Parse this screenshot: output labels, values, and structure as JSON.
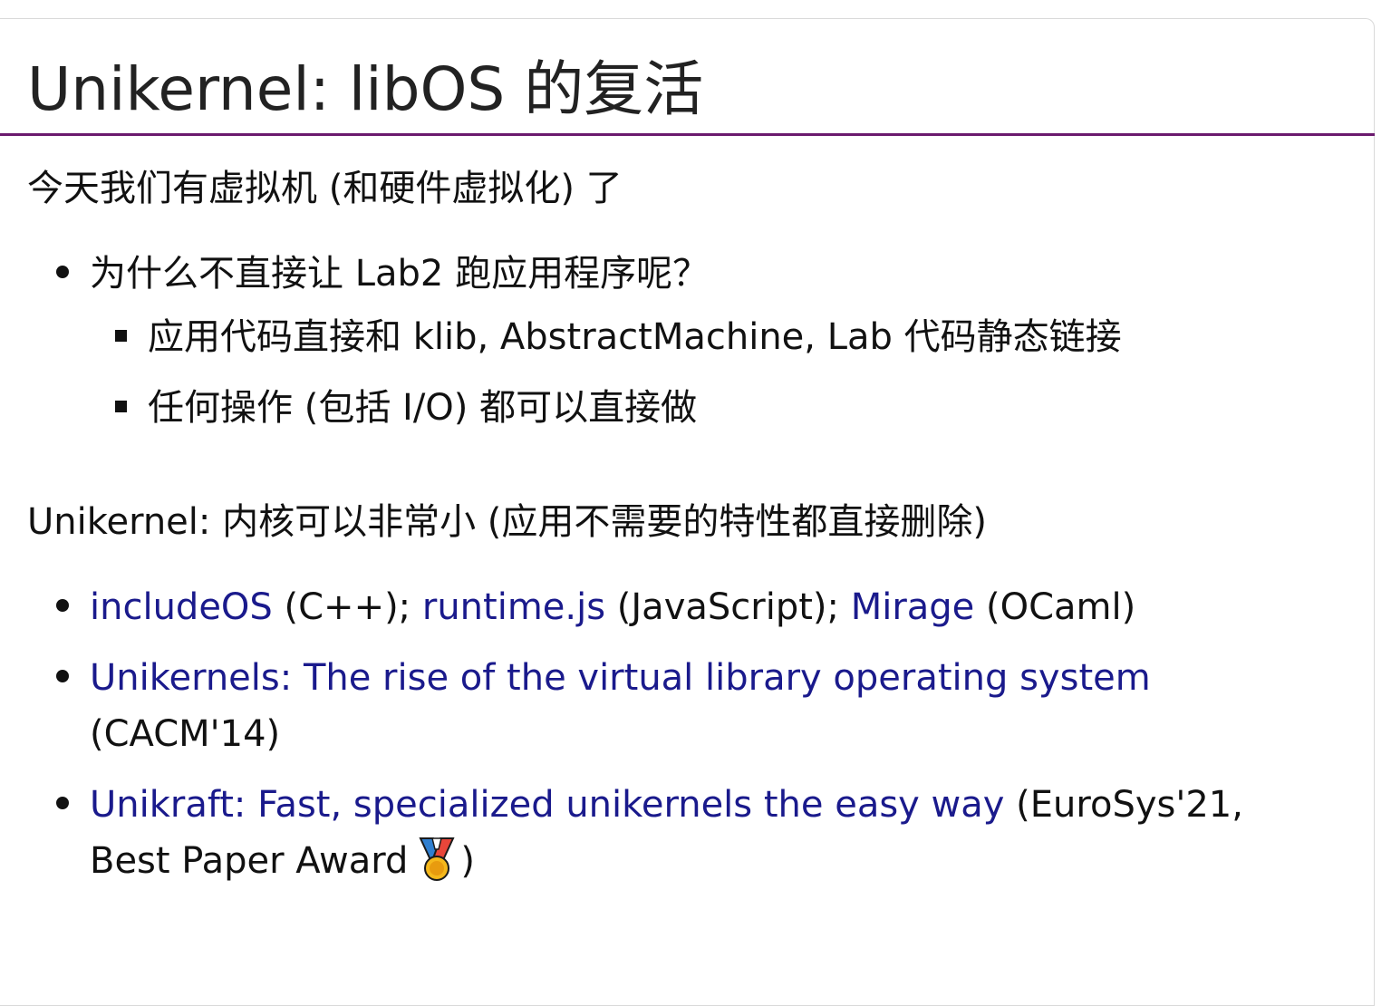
{
  "title": "Unikernel: libOS 的复活",
  "section1": {
    "intro": "今天我们有虚拟机 (和硬件虚拟化) 了",
    "bullet": "为什么不直接让 Lab2 跑应用程序呢？",
    "sub_items": [
      "应用代码直接和 klib, AbstractMachine, Lab 代码静态链接",
      "任何操作 (包括 I/O) 都可以直接做"
    ]
  },
  "section2": {
    "intro": "Unikernel: 内核可以非常小 (应用不需要的特性都直接删除)",
    "item1": {
      "link1": "includeOS",
      "text1": " (C++); ",
      "link2": "runtime.js",
      "text2": " (JavaScript); ",
      "link3": "Mirage",
      "text3": " (OCaml)"
    },
    "item2": {
      "link": "Unikernels: The rise of the virtual library operating system",
      "text": " (CACM'14)"
    },
    "item3": {
      "link": "Unikraft: Fast, specialized unikernels the easy way",
      "text_before_medal": " (EuroSys'21, Best Paper Award",
      "text_after_medal": ")",
      "medal_icon": "medal-icon"
    }
  },
  "colors": {
    "title_rule": "#6b1a6e",
    "link": "#1a1a8c",
    "text": "#111111"
  }
}
